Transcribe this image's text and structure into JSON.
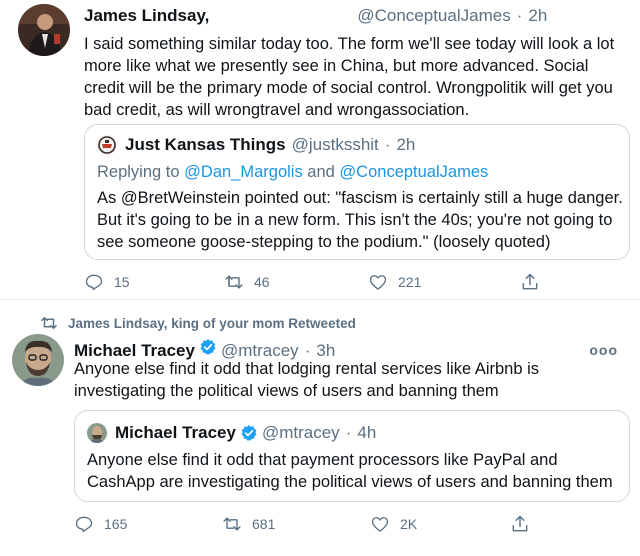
{
  "tweet1": {
    "name": "James Lindsay,",
    "handle": "@ConceptualJames",
    "time": "2h",
    "text": "I said something similar today too. The form we'll see today will look a lot more like what we presently see in China, but more advanced. Social credit will be the primary mode of social control. Wrongpolitik will get you bad credit, as will wrongtravel and wrongassociation.",
    "quote": {
      "name": "Just Kansas Things",
      "handle": "@justksshit",
      "time": "2h",
      "reply_prefix": "Replying to",
      "reply_user1": "@Dan_Margolis",
      "reply_and": "and",
      "reply_user2": "@ConceptualJames",
      "text": "As @BretWeinstein pointed out: \"fascism is certainly still a huge danger. But it's going to be in a new form. This isn't the 40s; you're not going to see someone goose-stepping to the podium.\" (loosely quoted)"
    },
    "actions": {
      "replies": "15",
      "retweets": "46",
      "likes": "221"
    }
  },
  "tweet2": {
    "retweeted_by": "James Lindsay, king of your mom Retweeted",
    "name": "Michael Tracey",
    "handle": "@mtracey",
    "time": "3h",
    "more": "ooo",
    "text": "Anyone else find it odd that lodging rental services like Airbnb is investigating the political views of users and banning them",
    "quote": {
      "name": "Michael Tracey",
      "handle": "@mtracey",
      "time": "4h",
      "text": "Anyone else find it odd that payment processors like PayPal and CashApp are investigating the political views of users and banning them"
    },
    "actions": {
      "replies": "165",
      "retweets": "681",
      "likes": "2K"
    }
  },
  "colors": {
    "accent": "#1b95e0",
    "secondary": "#5b7083",
    "verified": "#1da1f2",
    "border": "#cfd9de"
  },
  "icons": [
    "reply-icon",
    "retweet-icon",
    "like-icon",
    "share-icon",
    "verified-icon",
    "more-icon"
  ]
}
